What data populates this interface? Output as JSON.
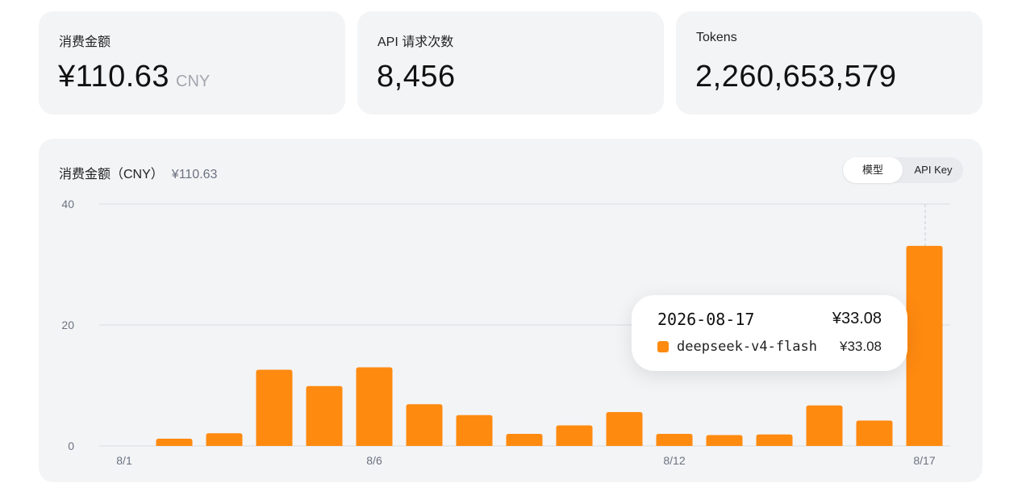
{
  "stats": [
    {
      "label": "消费金额",
      "value": "¥110.63",
      "unit": "CNY"
    },
    {
      "label": "API 请求次数",
      "value": "8,456",
      "unit": ""
    },
    {
      "label": "Tokens",
      "value": "2,260,653,579",
      "unit": ""
    }
  ],
  "chart_panel": {
    "title": "消费金额（CNY）",
    "total": "¥110.63",
    "toggle": {
      "options": [
        "模型",
        "API Key"
      ],
      "selected": "模型"
    }
  },
  "colors": {
    "bar": "#ff8a10",
    "grid": "#d9dbe0",
    "card": "#f3f4f6"
  },
  "chart_data": {
    "type": "bar",
    "title": "",
    "categories": [
      "8/1",
      "8/2",
      "8/3",
      "8/4",
      "8/5",
      "8/6",
      "8/7",
      "8/8",
      "8/9",
      "8/10",
      "8/11",
      "8/12",
      "8/13",
      "8/14",
      "8/15",
      "8/16",
      "8/17"
    ],
    "x_tick_labels": [
      "8/1",
      "8/6",
      "8/12",
      "8/17"
    ],
    "series": [
      {
        "name": "deepseek-v4-flash",
        "values": [
          0,
          1.2,
          2.1,
          12.6,
          9.9,
          13.0,
          6.9,
          5.1,
          2.0,
          3.4,
          5.6,
          2.0,
          1.8,
          1.9,
          6.7,
          4.2,
          33.08
        ]
      }
    ],
    "ylim": [
      0,
      40
    ],
    "y_ticks": [
      0,
      20,
      40
    ],
    "grid": true
  },
  "tooltip": {
    "date": "2026-08-17",
    "total": "¥33.08",
    "series_name": "deepseek-v4-flash",
    "series_value": "¥33.08"
  }
}
